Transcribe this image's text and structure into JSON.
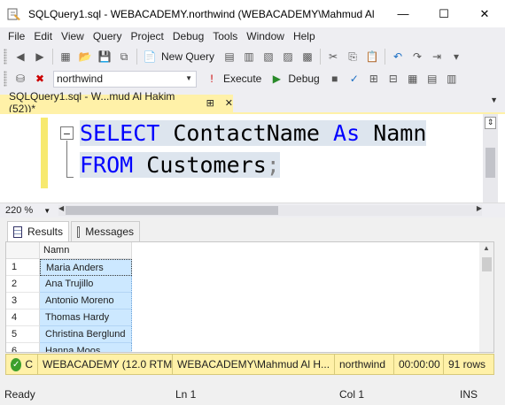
{
  "window": {
    "title": "SQLQuery1.sql - WEBACADEMY.northwind (WEBACADEMY\\Mahmud Al",
    "minimize_glyph": "—",
    "maximize_glyph": "☐",
    "close_glyph": "✕"
  },
  "menu": [
    "File",
    "Edit",
    "View",
    "Query",
    "Project",
    "Debug",
    "Tools",
    "Window",
    "Help"
  ],
  "toolbar": {
    "new_query_label": "New Query",
    "database_value": "northwind",
    "execute_label": "Execute",
    "debug_label": "Debug"
  },
  "document_tab": {
    "label": "SQLQuery1.sql - W...mud Al Hakim (52))*",
    "pin_glyph": "⊞",
    "close_glyph": "✕"
  },
  "editor": {
    "line1": {
      "kw1": "SELECT",
      "id1": "ContactName",
      "kw2": "As",
      "id2": "Namn"
    },
    "line2": {
      "kw1": "FROM",
      "id1": "Customers",
      "punct": ";"
    },
    "fold_glyph": "−",
    "zoom": "220 %"
  },
  "results": {
    "tabs": {
      "results": "Results",
      "messages": "Messages"
    },
    "column_header": "Namn",
    "rows": [
      {
        "num": "1",
        "value": "Maria Anders"
      },
      {
        "num": "2",
        "value": "Ana Trujillo"
      },
      {
        "num": "3",
        "value": "Antonio Moreno"
      },
      {
        "num": "4",
        "value": "Thomas Hardy"
      },
      {
        "num": "5",
        "value": "Christina Berglund"
      },
      {
        "num": "6",
        "value": "Hanna Moos"
      }
    ]
  },
  "query_status": {
    "state": "C",
    "server": "WEBACADEMY (12.0 RTM)",
    "user": "WEBACADEMY\\Mahmud Al H...",
    "database": "northwind",
    "time": "00:00:00",
    "rows": "91 rows"
  },
  "status_bar": {
    "ready": "Ready",
    "line": "Ln 1",
    "col": "Col 1",
    "mode": "INS"
  },
  "colors": {
    "keyword": "#0000ff",
    "tab_yellow": "#fff1a8",
    "selection": "#cce8ff",
    "ok_green": "#3c9f2c"
  }
}
